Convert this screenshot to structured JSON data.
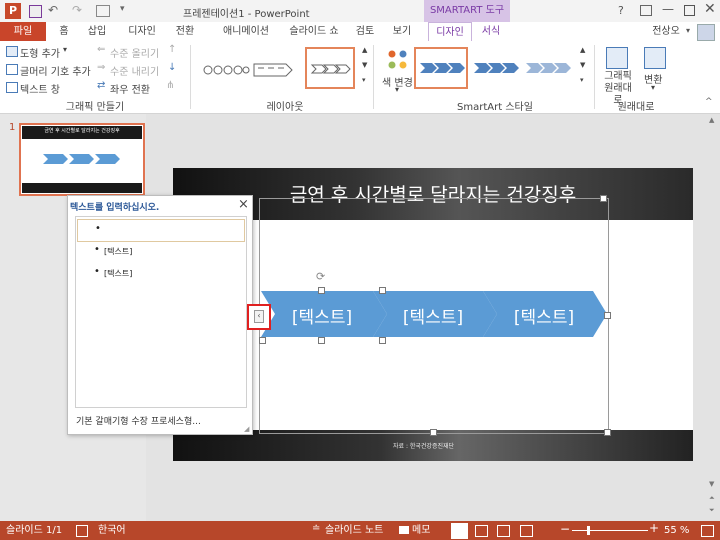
{
  "window": {
    "title": "프레젠테이션1 - PowerPoint",
    "contextual_tab_group": "SMARTART 도구",
    "help": "?",
    "user": "전상오"
  },
  "tabs": {
    "file": "파일",
    "home": "홈",
    "insert": "삽입",
    "design": "디자인",
    "transitions": "전환",
    "animations": "애니메이션",
    "slideshow": "슬라이드 쇼",
    "review": "검토",
    "view": "보기",
    "smart_design": "디자인",
    "format": "서식"
  },
  "ribbon": {
    "create_graphic": {
      "add_shape": "도형 추가",
      "add_bullet": "글머리 기호 추가",
      "text_pane": "텍스트 창",
      "promote": "수준 올리기",
      "demote": "수준 내리기",
      "right_to_left": "좌우 전환",
      "group_label": "그래픽 만들기"
    },
    "layouts": {
      "group_label": "레이아웃"
    },
    "styles": {
      "change_colors": "색 변경",
      "group_label": "SmartArt 스타일"
    },
    "reset": {
      "reset_graphic": "그래픽 원래대로",
      "convert": "변환",
      "group_label": "원래대로"
    }
  },
  "thumbnail": {
    "number": "1",
    "title": "금연 후 시간별로 달라지는 건강징후"
  },
  "slide": {
    "title": "금연 후 시간별로 달라지는 건강징후",
    "chevrons": [
      "[텍스트]",
      "[텍스트]",
      "[텍스트]"
    ],
    "source": "자료 : 한국건강증진재단"
  },
  "text_pane": {
    "title": "텍스트를 입력하십시오.",
    "close": "×",
    "items": [
      "",
      "[텍스트]",
      "[텍스트]"
    ],
    "footer": "기본 갈매기형 수장 프로세스형..."
  },
  "status": {
    "slide": "슬라이드 1/1",
    "language": "한국어",
    "notes": "슬라이드 노트",
    "comments": "메모",
    "zoom": "55 %"
  }
}
